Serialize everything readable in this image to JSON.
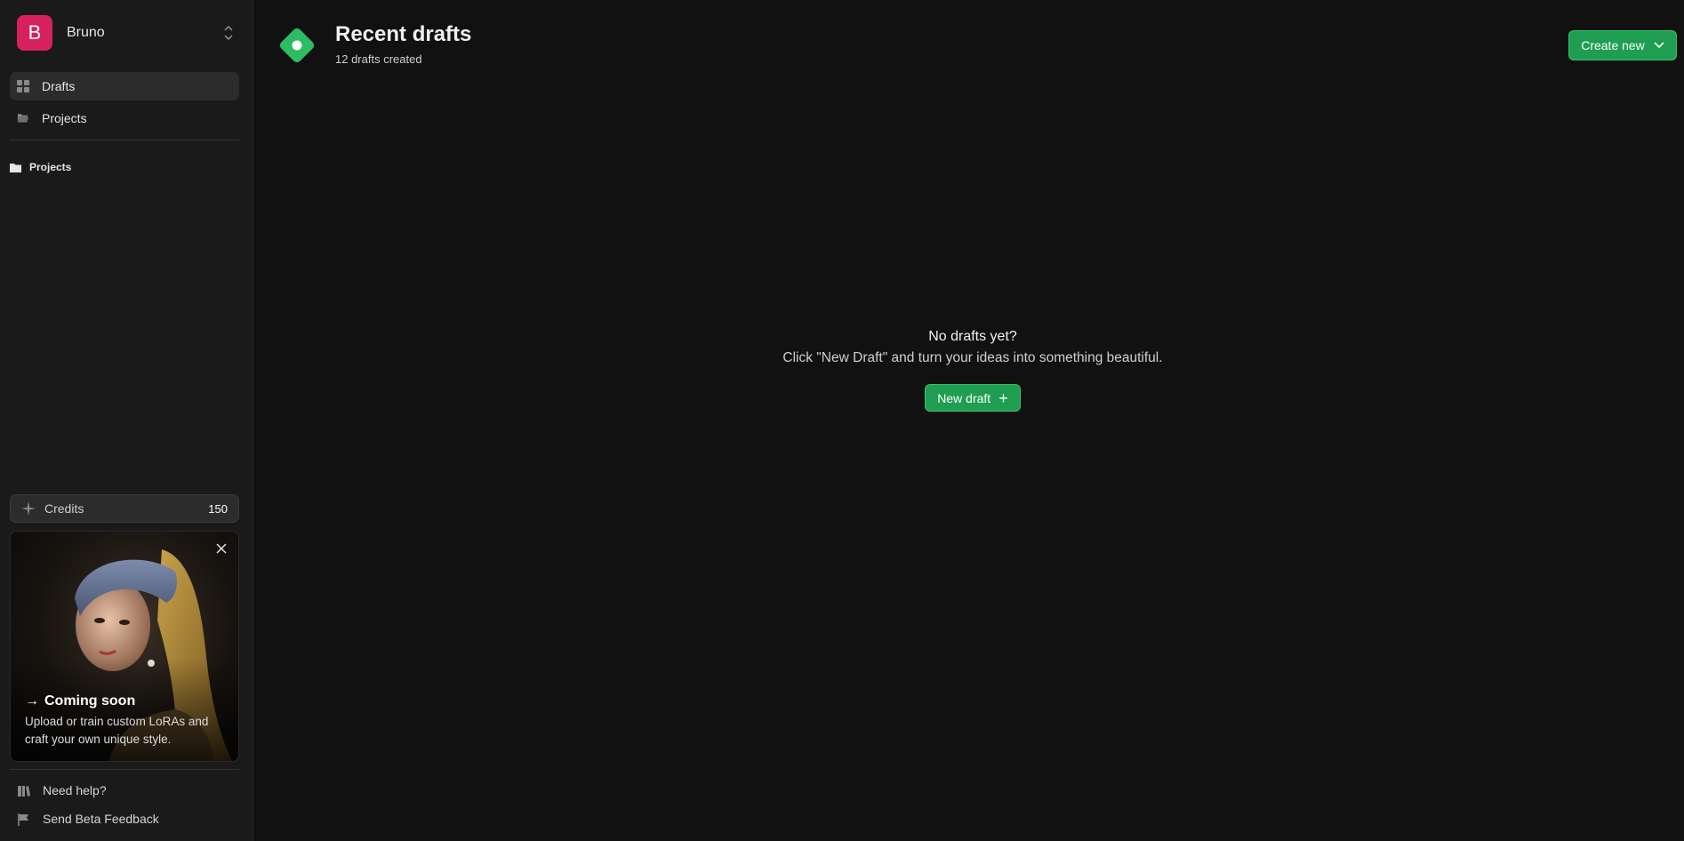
{
  "workspace": {
    "initial": "B",
    "name": "Bruno",
    "avatar_color": "#d6215e"
  },
  "sidebar": {
    "nav": [
      {
        "label": "Drafts",
        "icon": "grid-icon",
        "active": true
      },
      {
        "label": "Projects",
        "icon": "folder-open-icon",
        "active": false
      }
    ],
    "section_label": "Projects",
    "credits": {
      "label": "Credits",
      "value": "150"
    },
    "promo": {
      "title": "Coming soon",
      "description": "Upload or train custom LoRAs and craft your own unique style."
    },
    "footer": [
      {
        "label": "Need help?",
        "icon": "book-icon"
      },
      {
        "label": "Send Beta Feedback",
        "icon": "flag-icon"
      }
    ]
  },
  "header": {
    "title": "Recent drafts",
    "subtitle": "12 drafts created",
    "create_button": "Create new"
  },
  "empty_state": {
    "title": "No drafts yet?",
    "message": "Click \"New Draft\" and turn your ideas into something beautiful.",
    "button": "New draft"
  },
  "colors": {
    "accent": "#1f9e52",
    "background": "#111111",
    "sidebar": "#1a1a1a"
  }
}
